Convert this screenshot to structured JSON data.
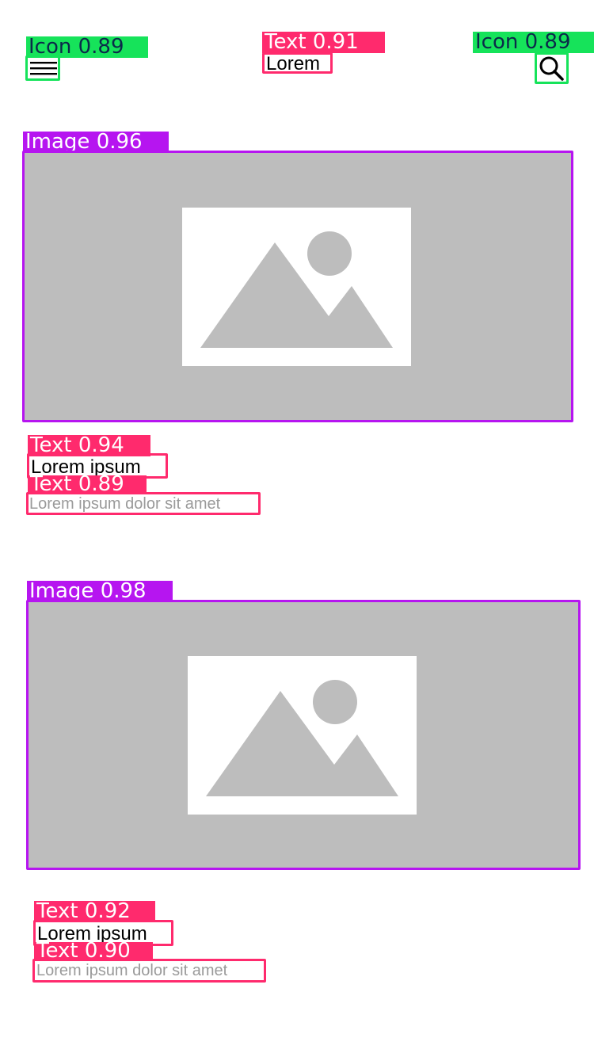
{
  "header": {
    "menu_icon": "hamburger-icon",
    "search_icon": "search-icon",
    "title": "Lorem"
  },
  "detections": {
    "menu_icon": "Icon 0.89",
    "title": "Text 0.91",
    "search_icon": "Icon 0.89",
    "image1": "Image 0.96",
    "card1_title": "Text 0.94",
    "card1_subtitle": "Text 0.89",
    "image2": "Image 0.98",
    "card2_title": "Text 0.92",
    "card2_subtitle": "Text 0.90"
  },
  "cards": [
    {
      "title": "Lorem ipsum",
      "subtitle": "Lorem ipsum dolor sit amet",
      "image_icon": "image-placeholder-icon"
    },
    {
      "title": "Lorem ipsum",
      "subtitle": "Lorem ipsum dolor sit amet",
      "image_icon": "image-placeholder-icon"
    }
  ],
  "colors": {
    "text_box": "#ff2a6d",
    "icon_box": "#16e35a",
    "image_box": "#b615f0",
    "image_fill": "#bdbdbd",
    "subtitle_text": "#9a9a9a"
  }
}
